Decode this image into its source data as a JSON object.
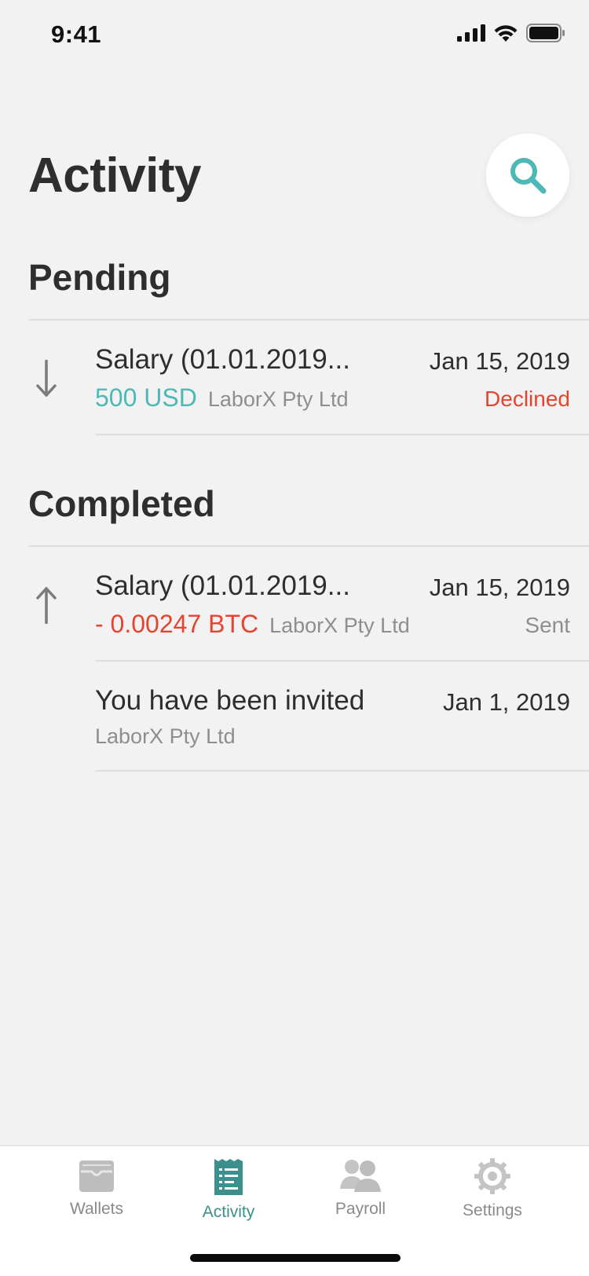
{
  "status_bar": {
    "time": "9:41"
  },
  "header": {
    "title": "Activity"
  },
  "pending": {
    "title": "Pending",
    "items": [
      {
        "title": "Salary (01.01.2019...",
        "date": "Jan 15, 2019",
        "amount": "500 USD",
        "company": "LaborX Pty Ltd",
        "status": "Declined",
        "direction_icon": "arrow-down-icon"
      }
    ]
  },
  "completed": {
    "title": "Completed",
    "items": [
      {
        "title": "Salary (01.01.2019...",
        "date": "Jan 15, 2019",
        "amount": "- 0.00247 BTC",
        "company": "LaborX Pty Ltd",
        "status": "Sent",
        "direction_icon": "arrow-up-icon"
      },
      {
        "title": "You have been invited",
        "date": "Jan 1, 2019",
        "company": "LaborX Pty Ltd"
      }
    ]
  },
  "tab_bar": {
    "tabs": [
      {
        "label": "Wallets",
        "icon": "wallet-icon"
      },
      {
        "label": "Activity",
        "icon": "receipt-icon",
        "active": true
      },
      {
        "label": "Payroll",
        "icon": "people-icon"
      },
      {
        "label": "Settings",
        "icon": "gear-icon"
      }
    ]
  },
  "colors": {
    "accent": "#4db8b5",
    "active_tab": "#3b8f8d",
    "negative": "#e5442f",
    "muted": "#8e8e8e",
    "background": "#f2f2f2"
  }
}
